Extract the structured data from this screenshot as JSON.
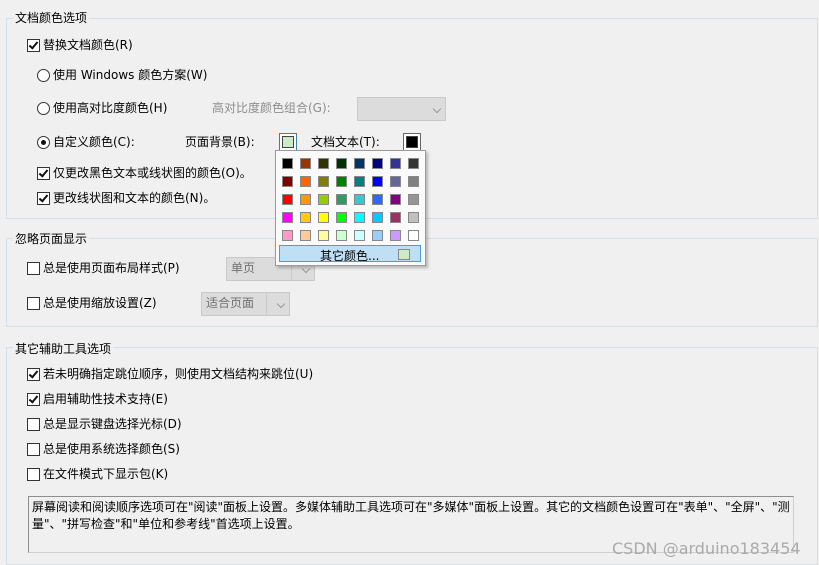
{
  "doc_colors": {
    "title": "文档颜色选项",
    "replace_label": "替换文档颜色(R)",
    "windows_scheme_label": "使用 Windows 颜色方案(W)",
    "high_contrast_label": "使用高对比度颜色(H)",
    "high_contrast_combo_label": "高对比度颜色组合(G):",
    "custom_label": "自定义颜色(C):",
    "page_bg_label": "页面背景(B):",
    "page_bg_color": "#ccecc8",
    "doc_text_label": "文档文本(T):",
    "doc_text_color": "#000000",
    "only_black_label": "仅更改黑色文本或线状图的颜色(O)。",
    "change_line_label": "更改线状图和文本的颜色(N)。"
  },
  "color_popup": {
    "rows": [
      [
        "#000000",
        "#993300",
        "#333300",
        "#003300",
        "#003366",
        "#000080",
        "#333399",
        "#333333"
      ],
      [
        "#800000",
        "#ff6600",
        "#808000",
        "#008000",
        "#008080",
        "#0000ff",
        "#666699",
        "#808080"
      ],
      [
        "#ff0000",
        "#ff9900",
        "#99cc00",
        "#339966",
        "#33cccc",
        "#3366ff",
        "#800080",
        "#969696"
      ],
      [
        "#ff00ff",
        "#ffcc00",
        "#ffff00",
        "#00ff00",
        "#00ffff",
        "#00ccff",
        "#993366",
        "#c0c0c0"
      ],
      [
        "#ff99cc",
        "#ffcc99",
        "#ffff99",
        "#ccffcc",
        "#ccffff",
        "#99ccff",
        "#cc99ff",
        "#ffffff"
      ]
    ],
    "more_colors_label": "其它颜色...",
    "current_color": "#ccecc8"
  },
  "ignore_page": {
    "title": "忽略页面显示",
    "layout_label": "总是使用页面布局样式(P)",
    "layout_value": "单页",
    "zoom_label": "总是使用缩放设置(Z)",
    "zoom_value": "适合页面"
  },
  "accessibility": {
    "title": "其它辅助工具选项",
    "tab_order_label": "若未明确指定跳位顺序，则使用文档结构来跳位(U)",
    "assistive_label": "启用辅助性技术支持(E)",
    "cursor_label": "总是显示键盘选择光标(D)",
    "sys_select_label": "总是使用系统选择颜色(S)",
    "document_mode_label": "在文件模式下显示包(K)",
    "info_text": "屏幕阅读和阅读顺序选项可在\"阅读\"面板上设置。多媒体辅助工具选项可在\"多媒体\"面板上设置。其它的文档颜色设置可在\"表单\"、\"全屏\"、\"测量\"、\"拼写检查\"和\"单位和参考线\"首选项上设置。"
  },
  "watermark": "CSDN @arduino183454"
}
